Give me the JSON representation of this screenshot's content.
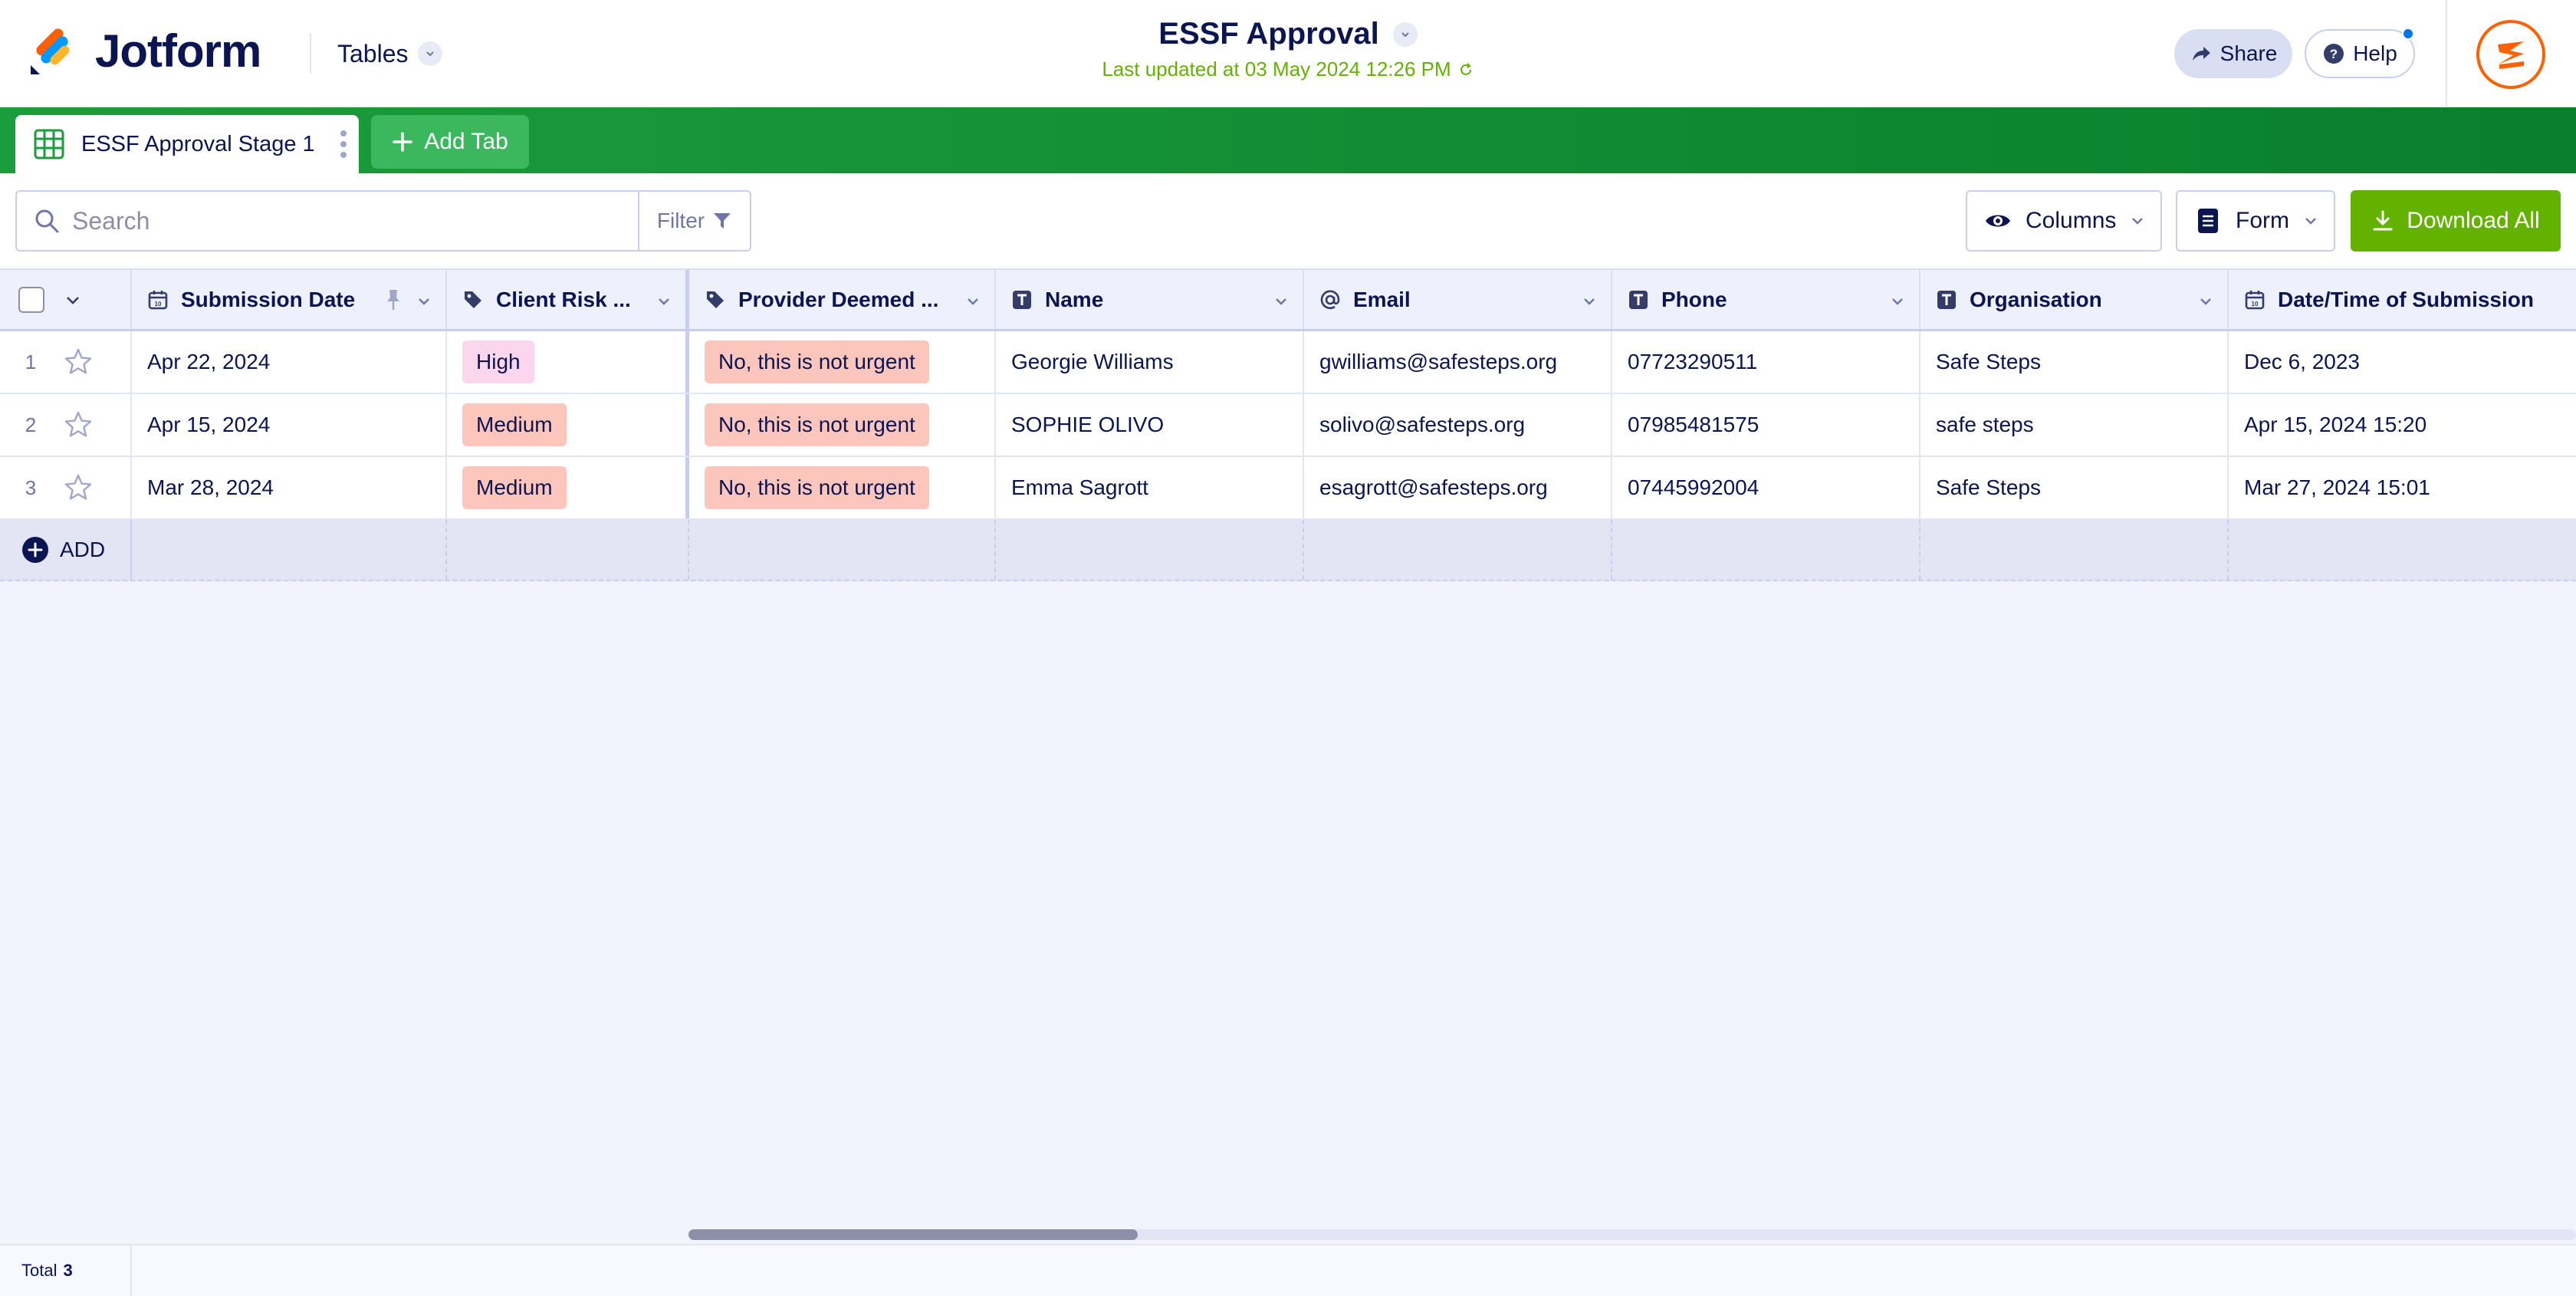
{
  "brand": {
    "name": "Jotform"
  },
  "header": {
    "tables_label": "Tables",
    "title": "ESSF Approval",
    "last_updated": "Last updated at 03 May 2024 12:26 PM",
    "share_label": "Share",
    "help_label": "Help"
  },
  "tabs": {
    "active_label": "ESSF Approval Stage 1",
    "add_label": "Add Tab"
  },
  "toolbar": {
    "search_placeholder": "Search",
    "filter_label": "Filter",
    "columns_label": "Columns",
    "form_label": "Form",
    "download_label": "Download All"
  },
  "columns": [
    {
      "label": "Submission Date",
      "icon": "calendar-icon"
    },
    {
      "label": "Client Risk ...",
      "icon": "tag-icon"
    },
    {
      "label": "Provider Deemed ...",
      "icon": "tag-icon"
    },
    {
      "label": "Name",
      "icon": "text-icon"
    },
    {
      "label": "Email",
      "icon": "at-icon"
    },
    {
      "label": "Phone",
      "icon": "text-icon"
    },
    {
      "label": "Organisation",
      "icon": "text-icon"
    },
    {
      "label": "Date/Time of Submission",
      "icon": "calendar-icon"
    }
  ],
  "rows": [
    {
      "num": "1",
      "submission_date": "Apr 22, 2024",
      "client_risk": "High",
      "provider_deemed": "No, this is not urgent",
      "name": "Georgie Williams",
      "email": "gwilliams@safesteps.org",
      "phone": "07723290511",
      "organisation": "Safe Steps",
      "datetime": "Dec 6, 2023"
    },
    {
      "num": "2",
      "submission_date": "Apr 15, 2024",
      "client_risk": "Medium",
      "provider_deemed": "No, this is not urgent",
      "name": "SOPHIE OLIVO",
      "email": "solivo@safesteps.org",
      "phone": "07985481575",
      "organisation": "safe steps",
      "datetime": "Apr 15, 2024 15:20"
    },
    {
      "num": "3",
      "submission_date": "Mar 28, 2024",
      "client_risk": "Medium",
      "provider_deemed": "No, this is not urgent",
      "name": "Emma Sagrott",
      "email": "esagrott@safesteps.org",
      "phone": "07445992004",
      "organisation": "Safe Steps",
      "datetime": "Mar 27, 2024 15:01"
    }
  ],
  "add_row_label": "ADD",
  "footer": {
    "total_label": "Total",
    "total_count": "3"
  },
  "colors": {
    "brand_navy": "#0a1551",
    "tab_green": "#0a7f2e",
    "download_green": "#64b200",
    "badge_high": "#fcd6ed",
    "badge_medium": "#fcc6bd",
    "avatar_orange": "#ff6100"
  }
}
